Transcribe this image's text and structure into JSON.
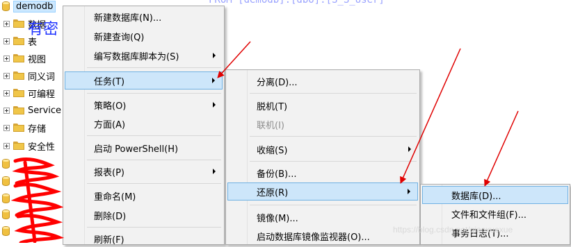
{
  "code_line": "FROM [demodb].[dbo].[S_S_User]",
  "tree": {
    "selected_db": "demodb",
    "items": [
      "数据",
      "表",
      "视图",
      "同义词",
      "可编程",
      "Service",
      "存储",
      "安全性"
    ],
    "handwritten_note": "有密"
  },
  "menu_main": {
    "items": [
      {
        "label": "新建数据库(N)..."
      },
      {
        "label": "新建查询(Q)"
      },
      {
        "label": "编写数据库脚本为(S)"
      },
      {
        "label": "任务(T)"
      },
      {
        "label": "策略(O)"
      },
      {
        "label": "方面(A)"
      },
      {
        "label": "启动 PowerShell(H)"
      },
      {
        "label": "报表(P)"
      },
      {
        "label": "重命名(M)"
      },
      {
        "label": "删除(D)"
      },
      {
        "label": "刷新(F)"
      }
    ]
  },
  "menu_tasks": {
    "items": [
      {
        "label": "分离(D)..."
      },
      {
        "label": "脱机(T)"
      },
      {
        "label": "联机(I)"
      },
      {
        "label": "收缩(S)"
      },
      {
        "label": "备份(B)..."
      },
      {
        "label": "还原(R)"
      },
      {
        "label": "镜像(M)..."
      },
      {
        "label": "启动数据库镜像监视器(O)..."
      }
    ]
  },
  "menu_restore": {
    "items": [
      {
        "label": "数据库(D)..."
      },
      {
        "label": "文件和文件组(F)..."
      },
      {
        "label": "事务日志(T)..."
      }
    ]
  },
  "watermark": "https://blog.csdn.net/qiaoxuexue",
  "colors": {
    "highlight": "#cde6fa",
    "highlight_border": "#6fb1e3",
    "arrow": "#ff0000",
    "scribble": "#ff0000",
    "menu_bg": "#f2f2f2"
  }
}
